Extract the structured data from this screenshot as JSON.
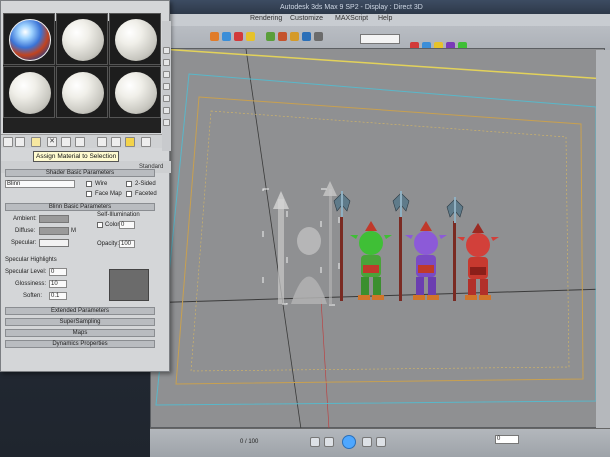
{
  "app": {
    "title": "Autodesk 3ds Max 9 SP2  -  Display : Direct 3D",
    "menu": [
      "Rendering",
      "Customize",
      "MAXScript",
      "Help"
    ]
  },
  "toolbar": {
    "selection_set": ""
  },
  "material_editor": {
    "tooltip": "Assign Material to Selection",
    "material_type": "Standard",
    "shader_rollout": "Shader Basic Parameters",
    "shader_type": "Blinn",
    "shader_options": [
      "Wire",
      "2-Sided",
      "Face Map",
      "Faceted"
    ],
    "blinn_rollout": "Blinn Basic Parameters",
    "self_illumination": "Self-Illumination",
    "color_label": "Color",
    "color_value": "0",
    "ambient_label": "Ambient:",
    "diffuse_label": "Diffuse:",
    "specular_label": "Specular:",
    "map_label": "M",
    "opacity_label": "Opacity:",
    "opacity_value": "100",
    "spec_highlights": "Specular Highlights",
    "spec_level_label": "Specular Level:",
    "spec_level_value": "0",
    "glossiness_label": "Glossiness:",
    "glossiness_value": "10",
    "soften_label": "Soften:",
    "soften_value": "0.1",
    "rollouts": [
      "Extended Parameters",
      "SuperSampling",
      "Maps",
      "Dynamics Properties"
    ],
    "colors": {
      "ambient": "#9a9a9a",
      "diffuse": "#9a9a9a",
      "specular": "#f2f2f2"
    }
  },
  "timeline": {
    "counter": "0 / 100",
    "frame": "0"
  },
  "scene": {
    "viewport_bg": "#8f9092",
    "safe_frame_outer": "#59b7c9",
    "safe_frame_inner": "#c8a050",
    "characters": [
      {
        "name": "green-goblin",
        "color": "#3fbf36"
      },
      {
        "name": "purple-goblin",
        "color": "#8c5ad8"
      },
      {
        "name": "red-goblin",
        "color": "#d2403a"
      }
    ]
  }
}
